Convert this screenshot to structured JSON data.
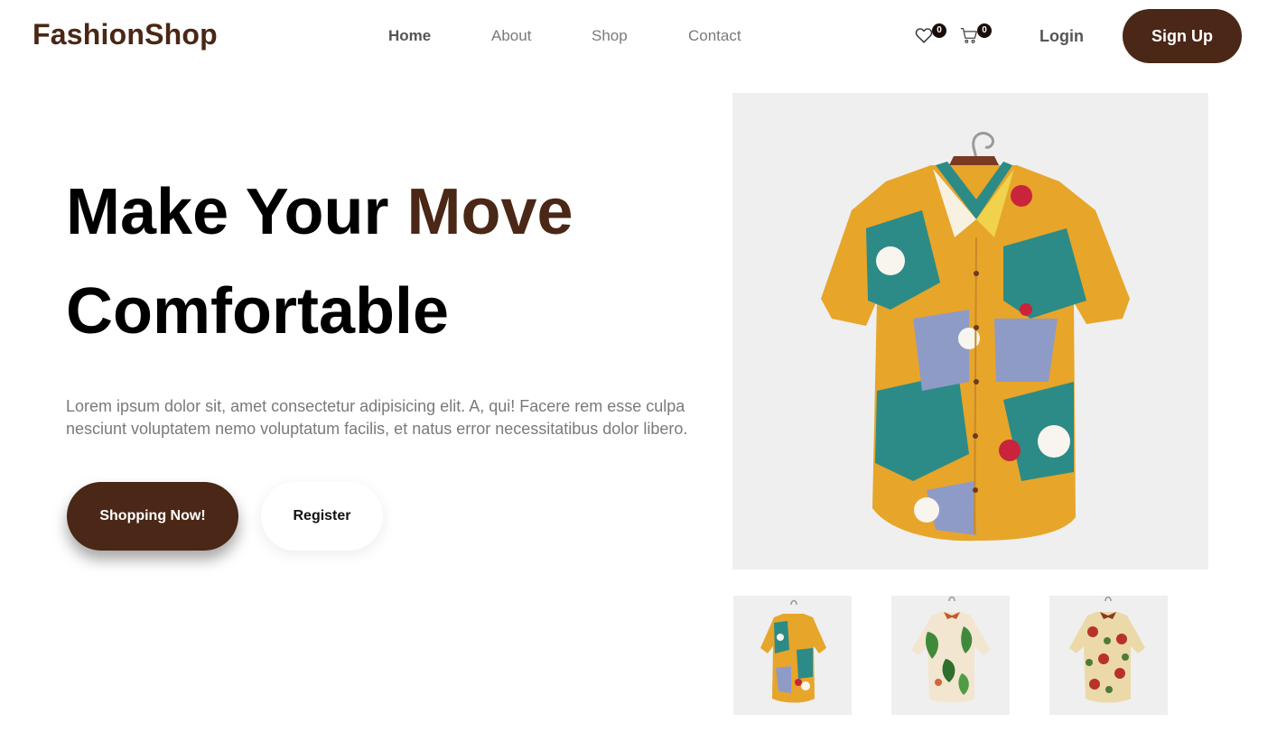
{
  "brand": {
    "name": "FashionShop",
    "color": "#4a2716"
  },
  "nav": {
    "links": [
      {
        "label": "Home",
        "active": true
      },
      {
        "label": "About",
        "active": false
      },
      {
        "label": "Shop",
        "active": false
      },
      {
        "label": "Contact",
        "active": false
      }
    ],
    "wishlist": {
      "icon": "heart-icon",
      "count": "0"
    },
    "cart": {
      "icon": "cart-icon",
      "count": "0"
    },
    "login_label": "Login",
    "signup_label": "Sign Up"
  },
  "hero": {
    "title_part1": "Make Your ",
    "title_accent": "Move",
    "title_line2": "Comfortable",
    "description": "Lorem ipsum dolor sit, amet consectetur adipisicing elit. A, qui! Facere rem esse culpa nesciunt voluptatem nemo voluptatum facilis, et natus error necessitatibus dolor libero.",
    "primary_button": "Shopping Now!",
    "secondary_button": "Register"
  },
  "product": {
    "main_image": "patterned-shirt",
    "thumbnails": [
      "patterned-shirt",
      "green-leaf-shirt",
      "red-floral-shirt"
    ]
  }
}
